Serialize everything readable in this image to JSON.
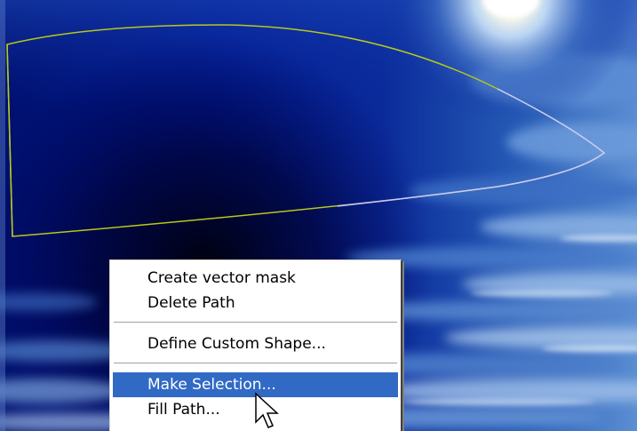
{
  "canvas": {
    "background_colors": {
      "deep": "#000a5c",
      "mid": "#0a2d9c",
      "cloud": "#7fa8dd",
      "moon": "#fff8e0"
    },
    "path_color_start": "#b8c81a",
    "path_color_end": "#c8c8ff"
  },
  "context_menu": {
    "items": [
      {
        "label": "Create vector mask",
        "state": "normal"
      },
      {
        "label": "Delete Path",
        "state": "normal"
      },
      {
        "label": "Define Custom Shape...",
        "state": "normal"
      },
      {
        "label": "Make Selection...",
        "state": "highlighted"
      },
      {
        "label": "Fill Path...",
        "state": "normal"
      }
    ],
    "highlight_color": "#316ac5"
  },
  "cursor": {
    "icon": "arrow-pointer-icon"
  }
}
